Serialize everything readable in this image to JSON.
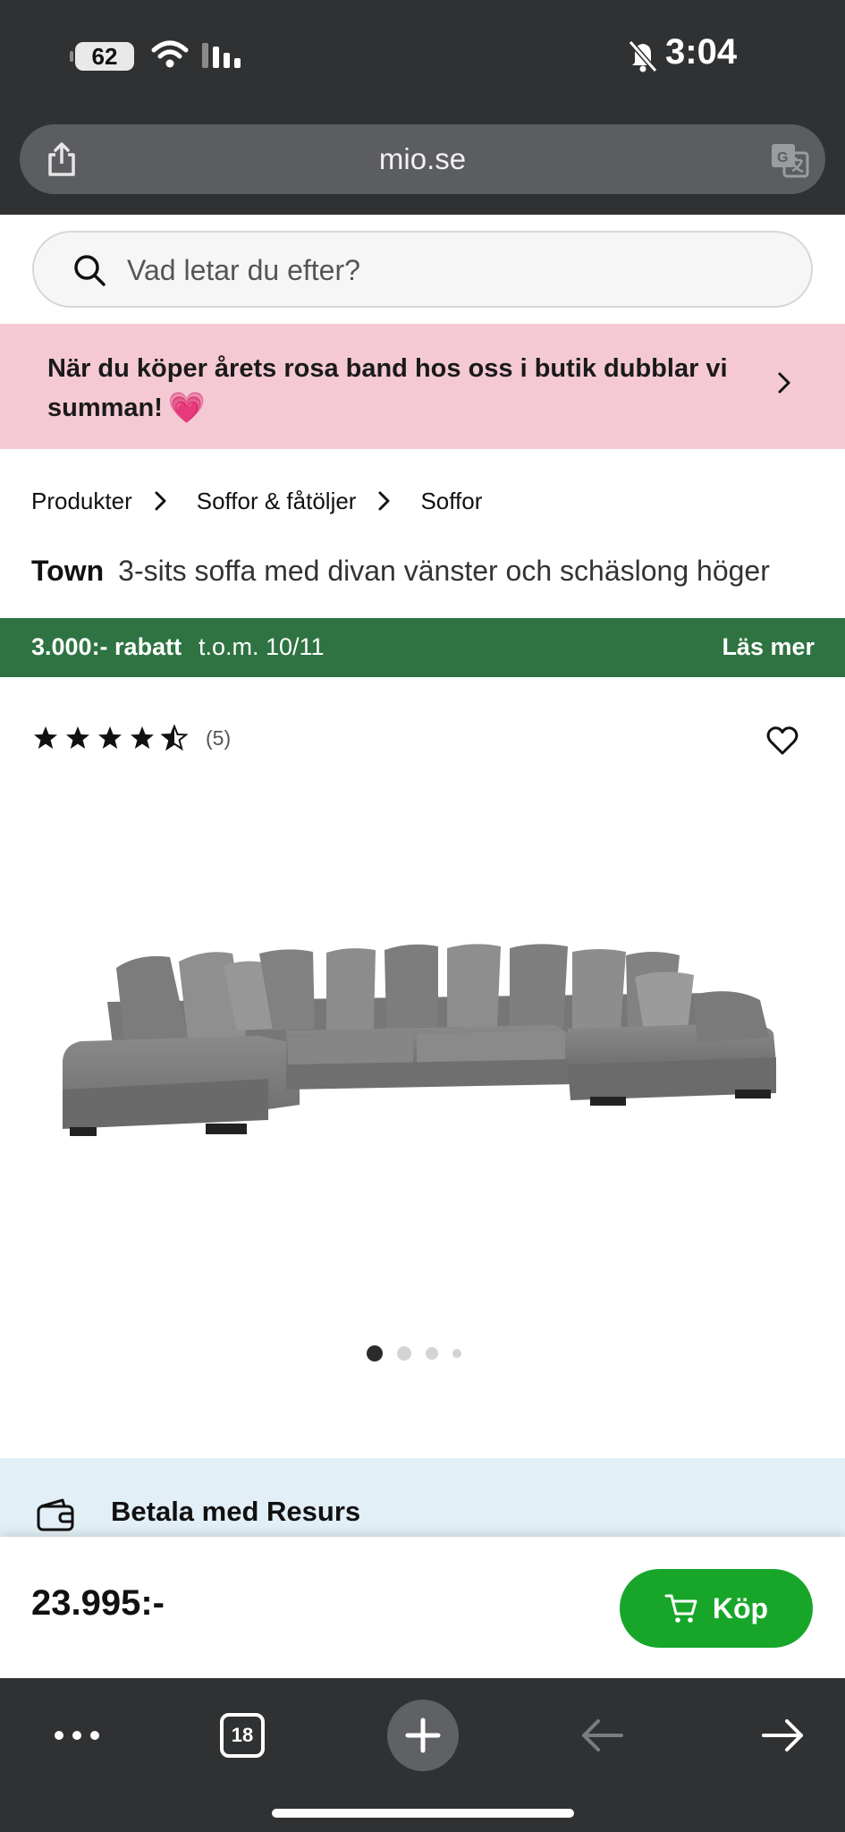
{
  "status_bar": {
    "battery": "62",
    "time": "3:04"
  },
  "browser": {
    "url": "mio.se",
    "tabs_count": "18"
  },
  "search": {
    "placeholder": "Vad letar du efter?"
  },
  "promo": {
    "text": "När du köper årets rosa band hos oss i butik dubblar vi summan!",
    "emoji": "💗"
  },
  "breadcrumb": [
    "Produkter",
    "Soffor & fåtöljer",
    "Soffor"
  ],
  "product": {
    "brand": "Town",
    "description": "3-sits soffa med divan vänster och schäslong höger",
    "rating": 4.5,
    "review_count": "(5)",
    "image_count": 4,
    "active_image": 1,
    "price": "23.995:-"
  },
  "discount": {
    "amount": "3.000:- rabatt",
    "date": "t.o.m. 10/11",
    "link": "Läs mer",
    "color": "#2e7341"
  },
  "payment": {
    "label": "Betala med Resurs"
  },
  "buy": {
    "label": "Köp",
    "color": "#17a629"
  },
  "icons": {
    "share": "share-icon",
    "translate": "translate-icon",
    "search": "search-icon",
    "chevron": "chevron-right-icon",
    "heart": "heart-outline-icon",
    "wallet": "wallet-icon",
    "cart": "cart-icon",
    "more": "more-icon",
    "plus": "plus-icon",
    "back": "arrow-left-icon",
    "forward": "arrow-right-icon"
  }
}
